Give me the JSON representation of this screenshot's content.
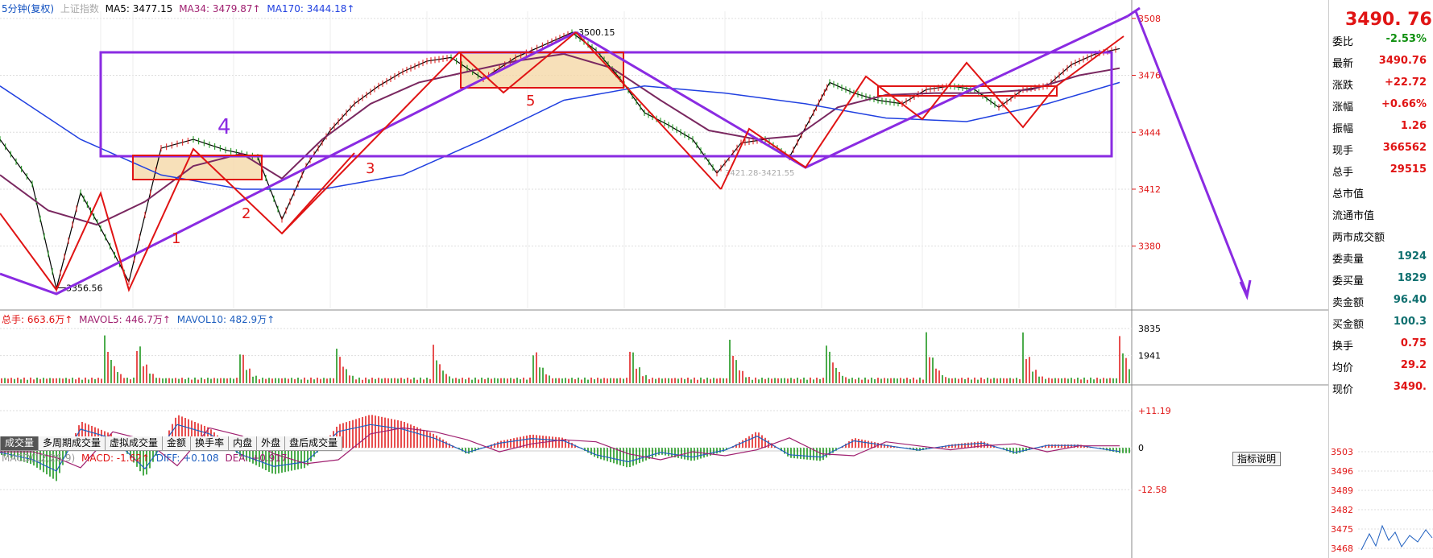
{
  "header": {
    "period_label": "5分钟(复权)",
    "index_name": "上证指数",
    "ma5": "MA5: 3477.15",
    "ma34": "MA34: 3479.87↑",
    "ma170": "MA170: 3444.18↑"
  },
  "volume_header": {
    "total": "总手: 663.6万↑",
    "mavol5": "MAVOL5: 446.7万↑",
    "mavol10": "MAVOL10: 482.9万↑"
  },
  "macd_header": {
    "title": "MACD(12,26,9)",
    "macd": "MACD: -1.62↑",
    "diff": "DIFF: +0.108",
    "dea": "DEA: +0.917"
  },
  "tabs": [
    "成交量",
    "多周期成交量",
    "虚拟成交量",
    "金额",
    "换手率",
    "内盘",
    "外盘",
    "盘后成交量"
  ],
  "help_button": "指标说明",
  "side_panel": {
    "price": "3490. 76",
    "rows": [
      {
        "label": "委比",
        "value": "-2.53%"
      },
      {
        "label": "最新",
        "value": "3490.76"
      },
      {
        "label": "涨跌",
        "value": "+22.72"
      },
      {
        "label": "涨幅",
        "value": "+0.66%"
      },
      {
        "label": "振幅",
        "value": "1.26"
      },
      {
        "label": "现手",
        "value": "366562"
      },
      {
        "label": "总手",
        "value": "29515"
      },
      {
        "label": "总市值",
        "value": ""
      },
      {
        "label": "流通市值",
        "value": ""
      },
      {
        "label": "两市成交额",
        "value": ""
      },
      {
        "label": "委卖量",
        "value": "1924"
      },
      {
        "label": "委买量",
        "value": "1829"
      },
      {
        "label": "卖金额",
        "value": "96.40"
      },
      {
        "label": "买金额",
        "value": "100.3"
      },
      {
        "label": "换手",
        "value": "0.75"
      },
      {
        "label": "均价",
        "value": "29.2"
      },
      {
        "label": "现价",
        "value": "3490."
      }
    ],
    "mini_ticks": [
      "3503",
      "3496",
      "3489",
      "3482",
      "3475",
      "3468"
    ]
  },
  "colors": {
    "up": "#e01414",
    "down": "#109010",
    "ma5": "#000000",
    "ma34": "#7a2860",
    "ma170": "#2040e0",
    "annotation": "#8a2be2",
    "box_fill": "#f5d8a8"
  },
  "chart_data": [
    {
      "type": "line",
      "name": "price-pane",
      "ylim": [
        3345,
        3512
      ],
      "yticks": [
        "3508",
        "3476",
        "3444",
        "3412",
        "3380"
      ],
      "price_labels": [
        "3500.15",
        "3356.56",
        "3421.28-3421.55"
      ],
      "annotations": [
        "1",
        "2",
        "3",
        "4",
        "5"
      ],
      "series": [
        {
          "name": "MA5",
          "x": [
            0,
            40,
            70,
            100,
            125,
            160,
            200,
            240,
            280,
            320,
            350,
            380,
            410,
            440,
            470,
            500,
            530,
            560,
            600,
            640,
            680,
            710,
            740,
            770,
            800,
            830,
            860,
            890,
            920,
            950,
            980,
            1010,
            1030,
            1060,
            1090,
            1120,
            1150,
            1180,
            1210,
            1240,
            1270,
            1300,
            1330,
            1360,
            1390
          ],
          "values": [
            3440,
            3415,
            3356,
            3410,
            3390,
            3360,
            3435,
            3440,
            3434,
            3430,
            3395,
            3425,
            3445,
            3460,
            3470,
            3478,
            3484,
            3486,
            3474,
            3486,
            3494,
            3500,
            3490,
            3474,
            3455,
            3448,
            3440,
            3421,
            3438,
            3440,
            3430,
            3455,
            3472,
            3466,
            3462,
            3460,
            3468,
            3470,
            3468,
            3458,
            3468,
            3470,
            3482,
            3488,
            3491
          ]
        },
        {
          "name": "MA34",
          "x": [
            0,
            60,
            120,
            180,
            240,
            300,
            350,
            400,
            460,
            520,
            580,
            640,
            700,
            760,
            820,
            880,
            940,
            990,
            1040,
            1100,
            1160,
            1220,
            1280,
            1340,
            1390
          ],
          "values": [
            3420,
            3400,
            3392,
            3405,
            3425,
            3432,
            3418,
            3440,
            3460,
            3472,
            3478,
            3484,
            3488,
            3480,
            3462,
            3445,
            3440,
            3442,
            3458,
            3465,
            3466,
            3466,
            3468,
            3476,
            3480
          ]
        },
        {
          "name": "MA170",
          "x": [
            0,
            100,
            200,
            300,
            400,
            500,
            600,
            700,
            800,
            900,
            1000,
            1100,
            1200,
            1300,
            1390
          ],
          "values": [
            3470,
            3440,
            3420,
            3412,
            3412,
            3420,
            3440,
            3462,
            3470,
            3466,
            3460,
            3452,
            3450,
            3460,
            3472
          ]
        }
      ]
    },
    {
      "type": "bar",
      "name": "volume-pane",
      "yticks": [
        "3835",
        "1941"
      ],
      "ylim": [
        0,
        4400
      ],
      "session_peaks": [
        130,
        170,
        295,
        415,
        535,
        660,
        780,
        905,
        1025,
        1150,
        1270,
        1390
      ]
    },
    {
      "type": "bar",
      "name": "macd-pane",
      "ylim": [
        -12.58,
        11.19
      ],
      "yticks": [
        "+11.19",
        "0",
        "-12.58"
      ],
      "series": [
        {
          "name": "MACD",
          "x": [
            0,
            40,
            70,
            100,
            140,
            180,
            220,
            260,
            300,
            340,
            380,
            420,
            460,
            500,
            540,
            580,
            620,
            660,
            700,
            740,
            780,
            820,
            860,
            900,
            940,
            980,
            1020,
            1060,
            1100,
            1140,
            1180,
            1220,
            1260,
            1300,
            1340,
            1390
          ],
          "values": [
            -2,
            -5,
            -10,
            8,
            4,
            -9,
            10,
            6,
            -3,
            -8,
            -6,
            7,
            10,
            8,
            4,
            -2,
            2,
            4,
            3,
            -3,
            -6,
            -2,
            -4,
            -1,
            5,
            -3,
            -4,
            3,
            1,
            -1,
            1,
            2,
            -2,
            1,
            1,
            -1.62
          ]
        }
      ]
    }
  ]
}
